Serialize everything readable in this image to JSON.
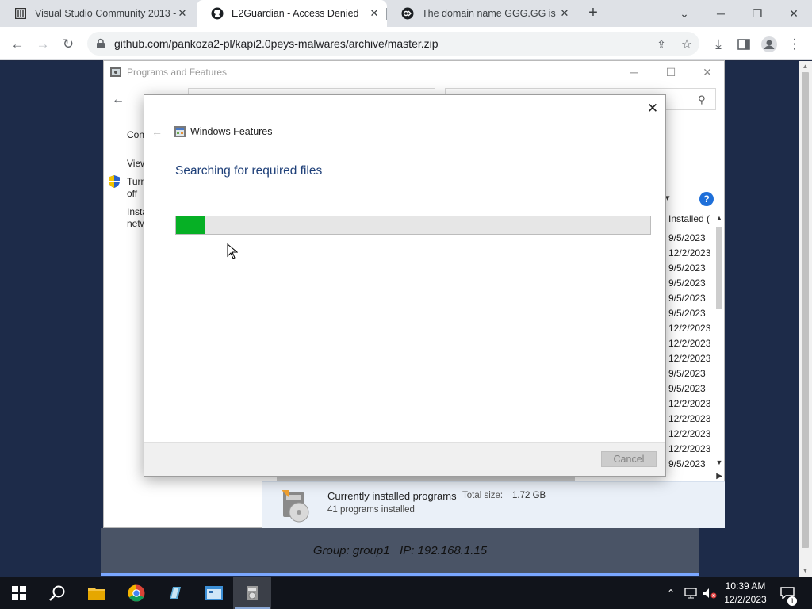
{
  "browser": {
    "tabs": [
      {
        "title": "Visual Studio Community 2013 - ",
        "icon": "visual-studio-icon",
        "active": false
      },
      {
        "title": "E2Guardian - Access Denied",
        "icon": "github-icon",
        "active": true
      },
      {
        "title": "The domain name GGG.GG is fo",
        "icon": "domain-site-icon",
        "active": false
      }
    ],
    "url": "github.com/pankoza2-pl/kapi2.0peys-malwares/archive/master.zip"
  },
  "programs_features": {
    "window_title": "Programs and Features",
    "sidebar_cut_labels": [
      "Con",
      "View",
      "Turn",
      "off",
      "Insta",
      "netw"
    ],
    "column_header": "Installed (",
    "installed_dates": [
      "9/5/2023",
      "12/2/2023",
      "9/5/2023",
      "9/5/2023",
      "9/5/2023",
      "9/5/2023",
      "12/2/2023",
      "12/2/2023",
      "12/2/2023",
      "9/5/2023",
      "9/5/2023",
      "12/2/2023",
      "12/2/2023",
      "12/2/2023",
      "12/2/2023",
      "9/5/2023"
    ],
    "details": {
      "title": "Currently installed programs",
      "total_size_label": "Total size:",
      "total_size_value": "1.72 GB",
      "count_text": "41 programs installed"
    }
  },
  "windows_features": {
    "title": "Windows Features",
    "status_heading": "Searching for required files",
    "progress_fraction": 0.06,
    "cancel_label": "Cancel",
    "close_symbol": "✕"
  },
  "remote_session": {
    "group_text": "Group: group1   IP: 192.168.1.15"
  },
  "taskbar": {
    "time": "10:39 AM",
    "date": "12/2/2023",
    "notification_count": "1"
  },
  "colors": {
    "progress_fill": "#06b025",
    "heading": "#1e3f78",
    "help": "#1e6fd9"
  }
}
